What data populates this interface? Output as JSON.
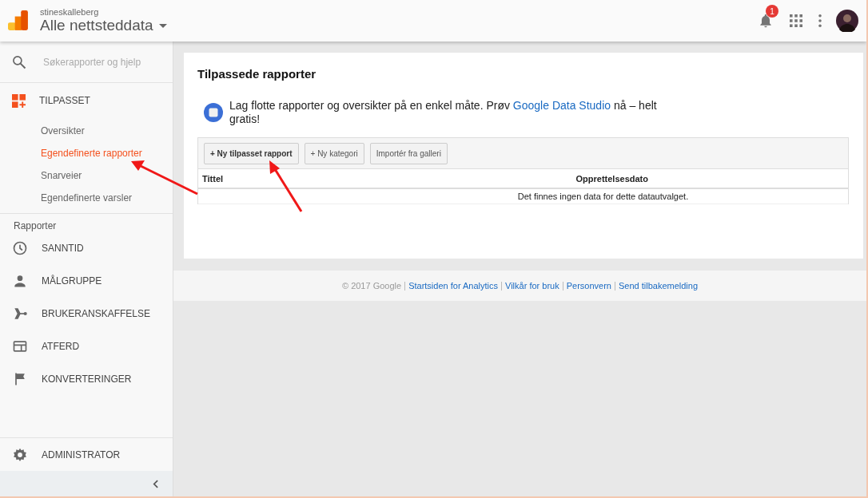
{
  "header": {
    "account": "stineskalleberg",
    "property": "Alle nettsteddata",
    "notification_count": "1"
  },
  "sidebar": {
    "search": {
      "placeholder": "Søkerapporter og hjelp"
    },
    "custom": {
      "label": "TILPASSET",
      "items": [
        {
          "label": "Oversikter",
          "selected": false
        },
        {
          "label": "Egendefinerte rapporter",
          "selected": true
        },
        {
          "label": "Snarveier",
          "selected": false
        },
        {
          "label": "Egendefinerte varsler",
          "selected": false
        }
      ]
    },
    "reports_heading": "Rapporter",
    "reports": [
      {
        "label": "SANNTID",
        "kind": "clock"
      },
      {
        "label": "MÅLGRUPPE",
        "kind": "person"
      },
      {
        "label": "BRUKERANSKAFFELSE",
        "kind": "acquisition"
      },
      {
        "label": "ATFERD",
        "kind": "behavior"
      },
      {
        "label": "KONVERTERINGER",
        "kind": "flag"
      }
    ],
    "admin": "ADMINISTRATOR"
  },
  "main": {
    "title": "Tilpassede rapporter",
    "promo": {
      "before": "Lag flotte rapporter og oversikter på en enkel måte. Prøv",
      "link": "Google Data Studio",
      "after": "nå – helt gratis!"
    },
    "buttons": [
      {
        "label": "+ Ny tilpasset rapport",
        "primary": true
      },
      {
        "label": "+ Ny kategori",
        "primary": false
      },
      {
        "label": "Importér fra galleri",
        "primary": false
      }
    ],
    "columns": [
      "Tittel",
      "Opprettelsesdato"
    ],
    "empty_message": "Det finnes ingen data for dette datautvalget."
  },
  "footer": {
    "copyright": "© 2017 Google",
    "links": [
      "Startsiden for Analytics",
      "Vilkår for bruk",
      "Personvern",
      "Send tilbakemelding"
    ]
  }
}
